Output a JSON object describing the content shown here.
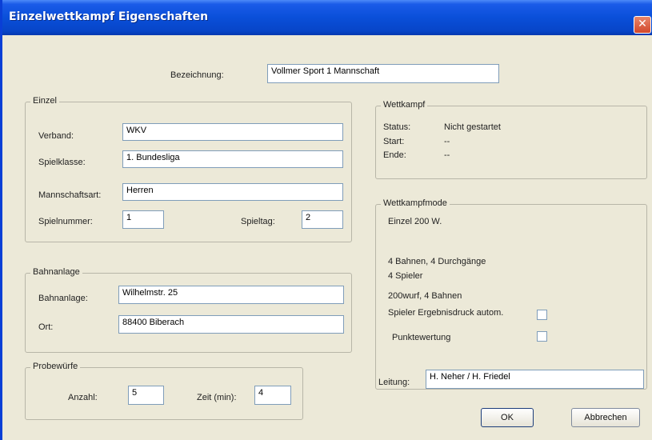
{
  "window": {
    "title": "Einzelwettkampf Eigenschaften",
    "close_glyph": "✕"
  },
  "bezeichnung": {
    "label": "Bezeichnung:",
    "value": "Vollmer Sport 1 Mannschaft"
  },
  "einzel": {
    "legend": "Einzel",
    "verband_label": "Verband:",
    "verband_value": "WKV",
    "spielklasse_label": "Spielklasse:",
    "spielklasse_value": "1. Bundesliga",
    "mannschaftsart_label": "Mannschaftsart:",
    "mannschaftsart_value": "Herren",
    "spielnummer_label": "Spielnummer:",
    "spielnummer_value": "1",
    "spieltag_label": "Spieltag:",
    "spieltag_value": "2"
  },
  "bahnanlage": {
    "legend": "Bahnanlage",
    "bahnanlage_label": "Bahnanlage:",
    "bahnanlage_value": "Wilhelmstr. 25",
    "ort_label": "Ort:",
    "ort_value": "88400 Biberach"
  },
  "probewuerfe": {
    "legend": "Probewürfe",
    "anzahl_label": "Anzahl:",
    "anzahl_value": "5",
    "zeit_label": "Zeit (min):",
    "zeit_value": "4"
  },
  "wettkampf": {
    "legend": "Wettkampf",
    "status_label": "Status:",
    "status_value": "Nicht gestartet",
    "start_label": "Start:",
    "start_value": "--",
    "ende_label": "Ende:",
    "ende_value": "--"
  },
  "wettkampfmode": {
    "legend": "Wettkampfmode",
    "line1": "Einzel 200 W.",
    "line2": "4 Bahnen, 4 Durchgänge",
    "line3": "4 Spieler",
    "line4": "200wurf, 4 Bahnen",
    "ergebnisdruck_label": "Spieler Ergebnisdruck autom.",
    "ergebnisdruck_checked": false,
    "punktewertung_label": "Punktewertung",
    "punktewertung_checked": false
  },
  "leitung": {
    "label": "Leitung:",
    "value": "H. Neher / H. Friedel"
  },
  "buttons": {
    "ok": "OK",
    "cancel": "Abbrechen"
  }
}
